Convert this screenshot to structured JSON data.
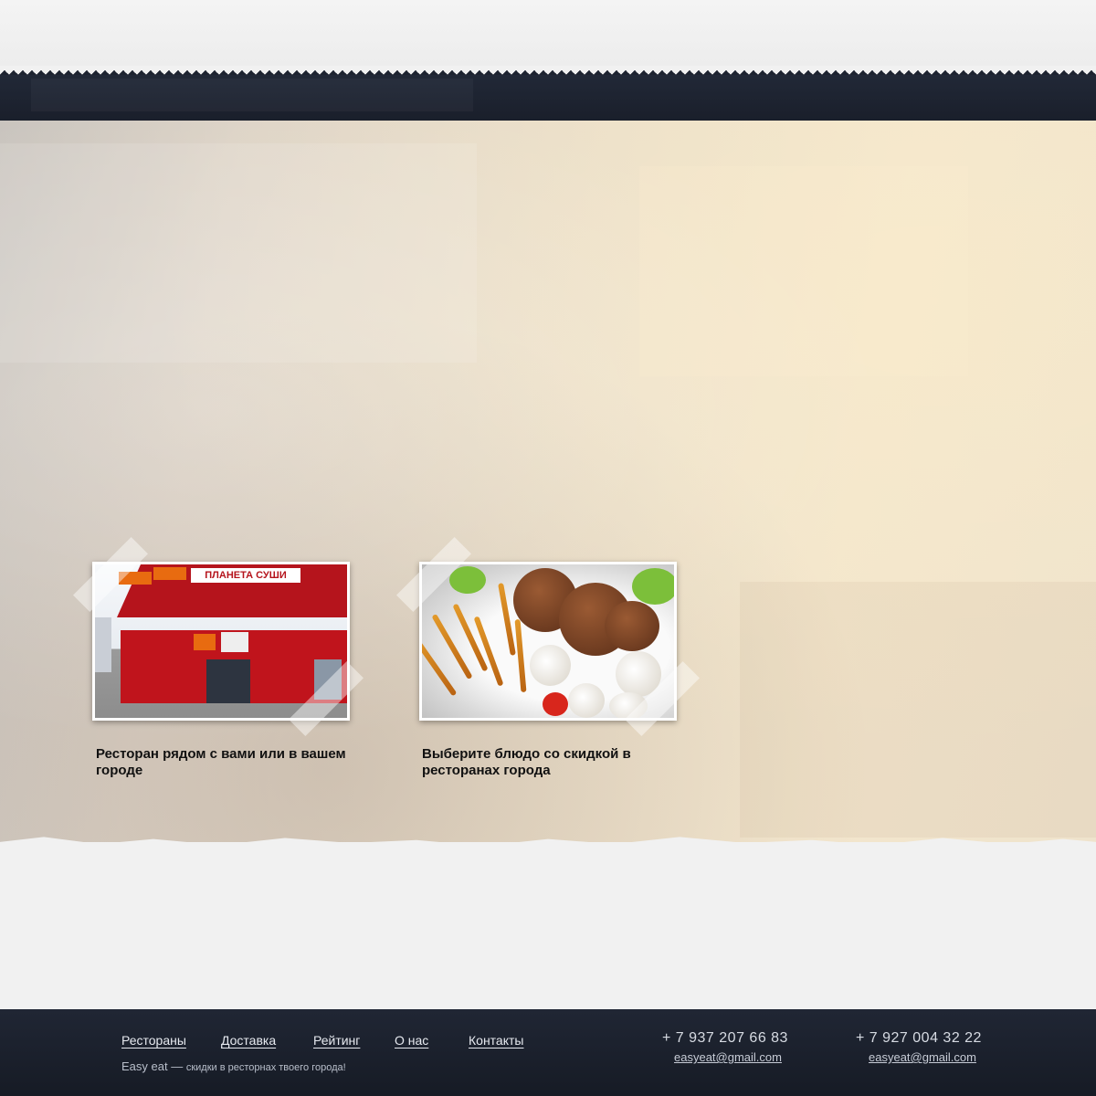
{
  "cards": [
    {
      "caption": "Ресторан рядом с вами или  в вашем городе",
      "photo_sign": "ПЛАНЕТА СУШИ"
    },
    {
      "caption": "Выберите блюдо со скидкой в ресторанах города"
    }
  ],
  "footer": {
    "nav": [
      "Рестораны",
      "Доставка",
      "Рейтинг",
      "О нас",
      "Контакты"
    ],
    "brand": "Easy eat",
    "dash": " — ",
    "tagline": "скидки в ресторнах твоего города!",
    "contacts": [
      {
        "phone": "+ 7 937 207 66 83",
        "email": "easyeat@gmail.com"
      },
      {
        "phone": "+ 7 927 004 32 22",
        "email": "easyeat@gmail.com"
      }
    ]
  },
  "colors": {
    "header_bg": "#1d2330",
    "footer_bg": "#1b202b",
    "accent_red": "#b5141c"
  }
}
